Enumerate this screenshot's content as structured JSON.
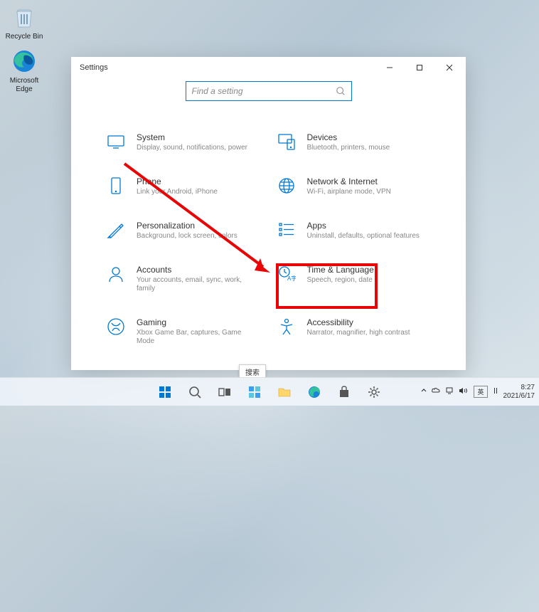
{
  "desktop": {
    "recycle_bin": "Recycle Bin",
    "edge": "Microsoft Edge"
  },
  "window": {
    "title": "Settings"
  },
  "search": {
    "placeholder": "Find a setting"
  },
  "categories": [
    {
      "title": "System",
      "desc": "Display, sound, notifications, power"
    },
    {
      "title": "Devices",
      "desc": "Bluetooth, printers, mouse"
    },
    {
      "title": "Phone",
      "desc": "Link your Android, iPhone"
    },
    {
      "title": "Network & Internet",
      "desc": "Wi-Fi, airplane mode, VPN"
    },
    {
      "title": "Personalization",
      "desc": "Background, lock screen, colors"
    },
    {
      "title": "Apps",
      "desc": "Uninstall, defaults, optional features"
    },
    {
      "title": "Accounts",
      "desc": "Your accounts, email, sync, work, family"
    },
    {
      "title": "Time & Language",
      "desc": "Speech, region, date"
    },
    {
      "title": "Gaming",
      "desc": "Xbox Game Bar, captures, Game Mode"
    },
    {
      "title": "Accessibility",
      "desc": "Narrator, magnifier, high contrast"
    }
  ],
  "tooltip": {
    "search": "搜索"
  },
  "tray": {
    "ime": "英",
    "time": "8:27",
    "date": "2021/6/17"
  }
}
